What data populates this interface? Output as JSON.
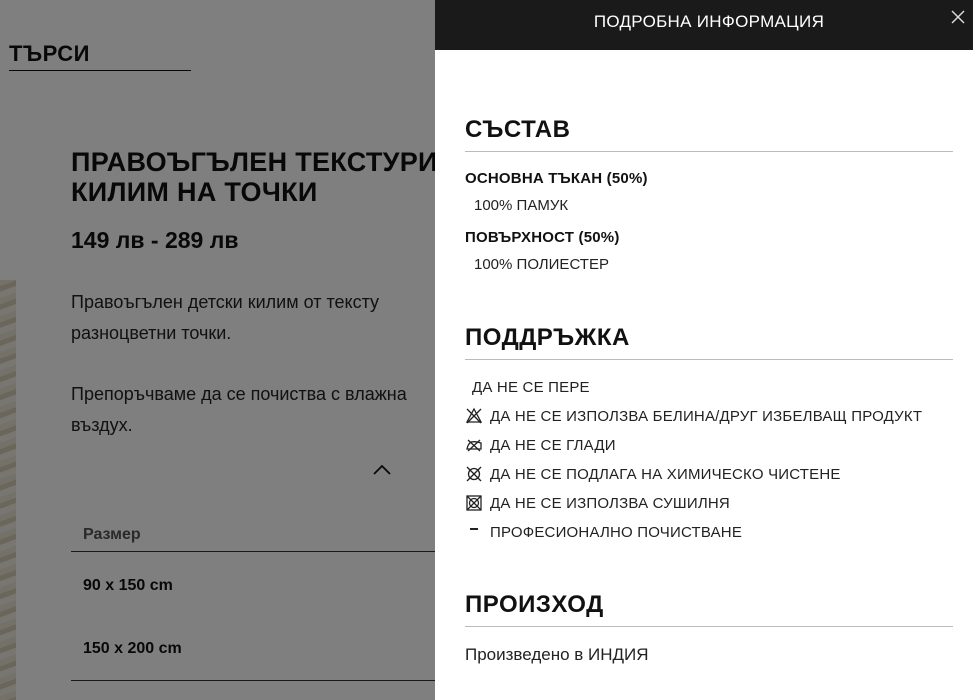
{
  "background": {
    "search_label": "ТЪРСИ",
    "product_title": "ПРАВОЪГЪЛЕН ТЕКСТУРИ\nКИЛИМ НА ТОЧКИ",
    "price": "149 лв - 289 лв",
    "description_1": "Правоъгълен детски килим от тексту\nразноцветни точки.",
    "description_2": "Препоръчваме да се почиства с влажна\nвъздух.",
    "size_table": {
      "header": "Размер",
      "rows": [
        "90 x 150 cm",
        "150 x 200 cm"
      ]
    }
  },
  "panel": {
    "title": "ПОДРОБНА ИНФОРМАЦИЯ",
    "composition": {
      "heading": "СЪСТАВ",
      "main_fabric_label": "ОСНОВНА ТЪКАН (50%)",
      "main_fabric_value": "100% ПАМУК",
      "surface_label": "ПОВЪРХНОСТ (50%)",
      "surface_value": "100% ПОЛИЕСТЕР"
    },
    "care": {
      "heading": "ПОДДРЪЖКА",
      "items": [
        {
          "icon": "none",
          "label": "ДА НЕ СЕ ПЕРЕ"
        },
        {
          "icon": "no-bleach-icon",
          "label": "ДА НЕ СЕ ИЗПОЛЗВА БЕЛИНА/ДРУГ ИЗБЕЛВАЩ ПРОДУКТ"
        },
        {
          "icon": "no-iron-icon",
          "label": "ДА НЕ СЕ ГЛАДИ"
        },
        {
          "icon": "no-dry-clean-icon",
          "label": "ДА НЕ СЕ ПОДЛАГА НА ХИМИЧЕСКО ЧИСТЕНЕ"
        },
        {
          "icon": "no-tumble-dry-icon",
          "label": "ДА НЕ СЕ ИЗПОЛЗВА СУШИЛНЯ"
        },
        {
          "icon": "professional-clean-icon",
          "label": "ПРОФЕСИОНАЛНО ПОЧИСТВАНЕ"
        }
      ]
    },
    "origin": {
      "heading": "ПРОИЗХОД",
      "text": "Произведено в ИНДИЯ"
    }
  },
  "colors": {
    "panel_header_bg": "#1a1a1a",
    "overlay": "rgba(0,0,0,0.5)"
  }
}
